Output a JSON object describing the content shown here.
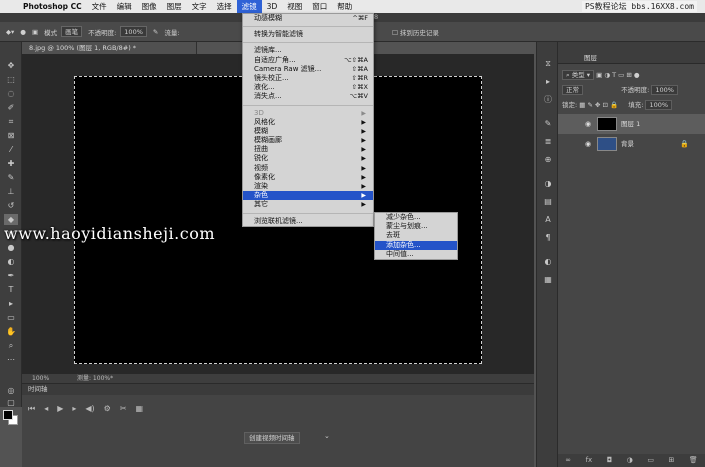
{
  "menubar": {
    "apple": "",
    "app": "Photoshop CC",
    "items": [
      "文件",
      "编辑",
      "图像",
      "图层",
      "文字",
      "选择",
      "滤镜",
      "3D",
      "视图",
      "窗口",
      "帮助"
    ],
    "active_index": 6
  },
  "watermark_top": "PS教程论坛 bbs.16XX8.com",
  "title_partial": "C 2018",
  "options": {
    "mode_label": "模式",
    "mode_value": "画笔",
    "opacity_label": "不透明度:",
    "opacity_value": "100%",
    "flow_label": "流量:",
    "erase_history_label": "抹到历史记录"
  },
  "document": {
    "tab_title": "8.jpg @ 100% (图层 1, RGB/8#) *",
    "zoom": "100%",
    "doc_info": "测量: 100%*"
  },
  "filter_menu": {
    "items": [
      {
        "label": "动感模糊",
        "shortcut": "^⌘F"
      },
      {
        "sep": true
      },
      {
        "label": "转换为智能滤镜"
      },
      {
        "sep": true
      },
      {
        "label": "滤镜库..."
      },
      {
        "label": "自适应广角...",
        "shortcut": "⌥⇧⌘A"
      },
      {
        "label": "Camera Raw 滤镜...",
        "shortcut": "⇧⌘A"
      },
      {
        "label": "镜头校正...",
        "shortcut": "⇧⌘R"
      },
      {
        "label": "液化...",
        "shortcut": "⇧⌘X"
      },
      {
        "label": "消失点...",
        "shortcut": "⌥⌘V"
      },
      {
        "sep": true
      },
      {
        "label": "3D",
        "submenu": true,
        "disabled": true
      },
      {
        "label": "风格化",
        "submenu": true
      },
      {
        "label": "模糊",
        "submenu": true
      },
      {
        "label": "模糊画廊",
        "submenu": true
      },
      {
        "label": "扭曲",
        "submenu": true
      },
      {
        "label": "锐化",
        "submenu": true
      },
      {
        "label": "视频",
        "submenu": true
      },
      {
        "label": "像素化",
        "submenu": true
      },
      {
        "label": "渲染",
        "submenu": true
      },
      {
        "label": "杂色",
        "submenu": true,
        "highlighted": true
      },
      {
        "label": "其它",
        "submenu": true
      },
      {
        "sep": true
      },
      {
        "label": "浏览联机滤镜..."
      }
    ]
  },
  "noise_submenu": {
    "items": [
      {
        "label": "减少杂色..."
      },
      {
        "label": "蒙尘与划痕..."
      },
      {
        "label": "去斑"
      },
      {
        "label": "添加杂色...",
        "highlighted": true
      },
      {
        "label": "中间值..."
      }
    ]
  },
  "watermark_mid": "www.haoyidiansheji.com",
  "timeline": {
    "title": "时间轴",
    "create_button": "创建视频时间轴"
  },
  "layers_panel": {
    "title": "图层",
    "filter_kind": "类型",
    "blend_mode": "正常",
    "opacity_label": "不透明度:",
    "opacity_value": "100%",
    "lock_label": "锁定:",
    "fill_label": "填充:",
    "fill_value": "100%",
    "layers": [
      {
        "name": "图层 1",
        "active": true,
        "thumb_color": "#000000"
      },
      {
        "name": "背景",
        "active": false,
        "thumb_color": "#2e4f86",
        "locked": true
      }
    ]
  }
}
